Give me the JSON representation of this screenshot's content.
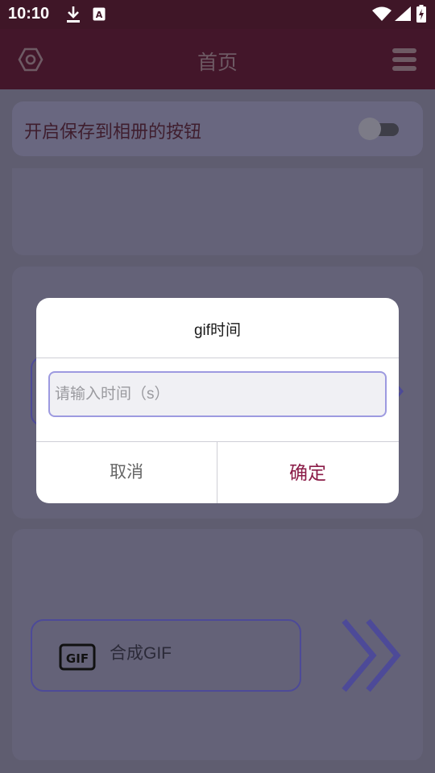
{
  "status_bar": {
    "time": "10:10",
    "icons": [
      "download-icon",
      "text-a-icon",
      "wifi-icon",
      "signal-icon",
      "battery-charging-icon"
    ]
  },
  "app_bar": {
    "title": "首页",
    "left_icon": "settings-hexagon-icon",
    "right_icon": "menu-icon"
  },
  "settings_card": {
    "label": "开启保存到相册的按钮",
    "toggle_on": false
  },
  "gif_card": {
    "button_label": "合成GIF",
    "icon": "gif-icon",
    "arrow_icon": "double-chevron-right-icon",
    "icon_text": "GIF"
  },
  "dialog": {
    "title": "gif时间",
    "input_placeholder": "请输入时间（s）",
    "input_value": "",
    "cancel_label": "取消",
    "confirm_label": "确定"
  },
  "colors": {
    "status_bar": "#3f1627",
    "app_bar": "#43162a",
    "accent": "#8b1d48",
    "input_border": "#9d9ae0",
    "card_border": "#4d4a98"
  }
}
